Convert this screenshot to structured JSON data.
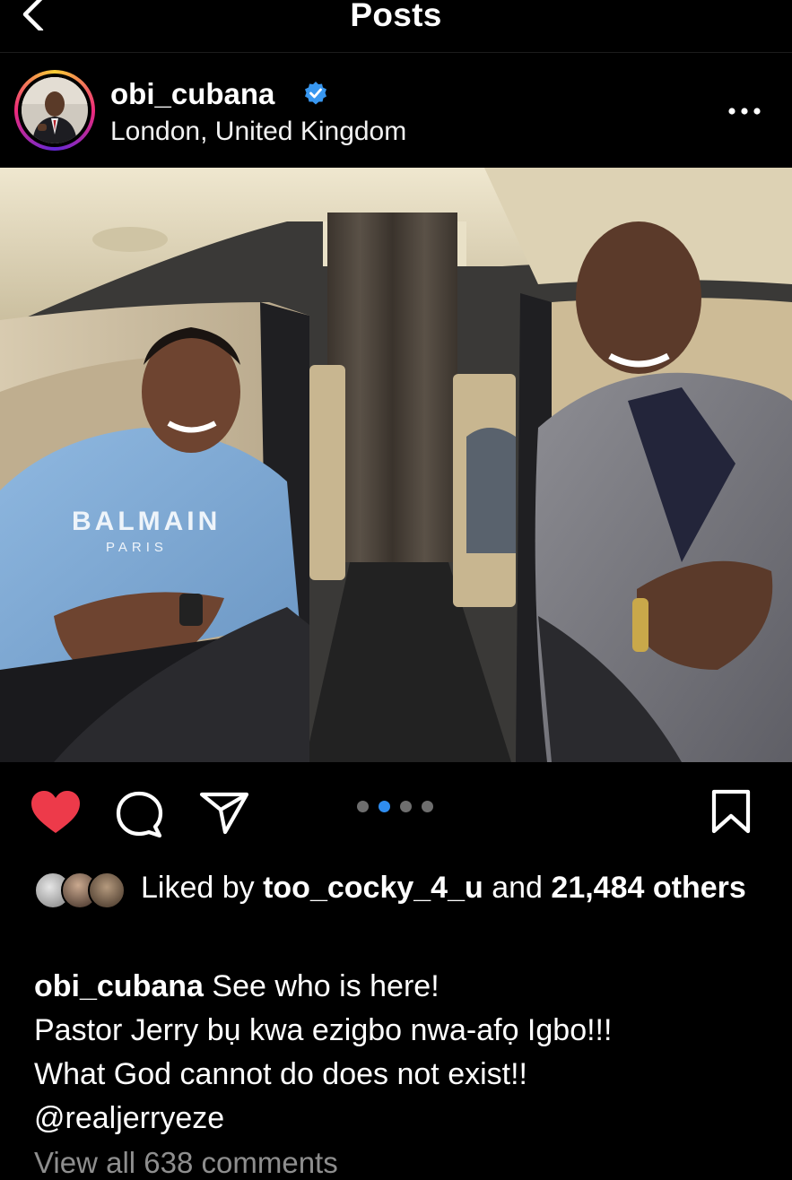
{
  "topbar": {
    "title": "Posts"
  },
  "post": {
    "username": "obi_cubana",
    "location": "London, United Kingdom",
    "carousel": {
      "count": 4,
      "active_index": 1
    }
  },
  "likes": {
    "prefix": "Liked by",
    "user": "too_cocky_4_u",
    "connector": "and",
    "count": "21,484",
    "suffix": "others"
  },
  "caption": {
    "username": "obi_cubana",
    "first_line": "See who is here!",
    "lines": [
      "Pastor Jerry bụ kwa ezigbo nwa-afọ Igbo!!!",
      "What God cannot do does not exist!!",
      "@realjerryeze"
    ]
  },
  "comments": {
    "link": "View all 638 comments"
  },
  "colors": {
    "like": "#ed3a4a",
    "accent": "#2f8df0",
    "verified": "#3897f0"
  },
  "icons": [
    "back-icon",
    "verified-icon",
    "more-icon",
    "heart-icon",
    "comment-icon",
    "share-icon",
    "bookmark-icon"
  ]
}
